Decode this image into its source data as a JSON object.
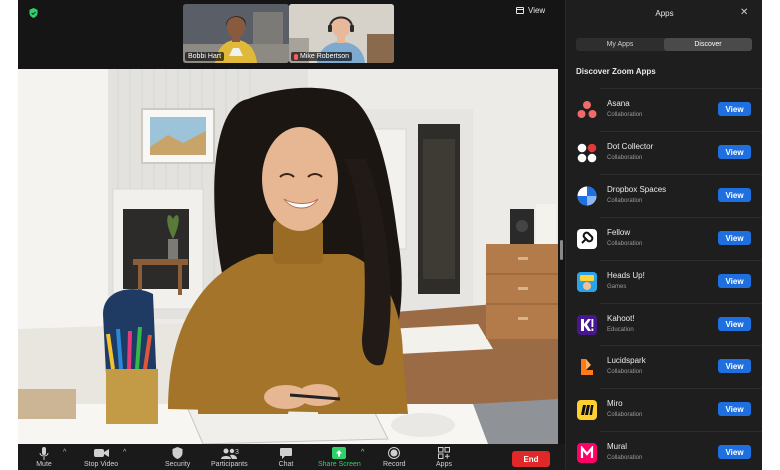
{
  "meeting": {
    "view_label": "View",
    "participants": [
      {
        "name": "Bobbi Hart",
        "muted": false
      },
      {
        "name": "Mike Robertson",
        "muted": true
      }
    ]
  },
  "toolbar": {
    "items": [
      {
        "label": "Mute",
        "icon": "microphone-icon"
      },
      {
        "label": "Stop Video",
        "icon": "video-camera-icon"
      },
      {
        "label": "Security",
        "icon": "shield-icon"
      },
      {
        "label": "Participants",
        "icon": "participants-icon",
        "count": "3"
      },
      {
        "label": "Chat",
        "icon": "chat-bubble-icon"
      },
      {
        "label": "Share Screen",
        "icon": "share-screen-icon"
      },
      {
        "label": "Record",
        "icon": "record-icon"
      },
      {
        "label": "Apps",
        "icon": "apps-icon"
      }
    ],
    "end_label": "End"
  },
  "apps_panel": {
    "title": "Apps",
    "tabs": [
      "My Apps",
      "Discover"
    ],
    "active_tab": "Discover",
    "section_title": "Discover Zoom Apps",
    "view_label": "View",
    "apps": [
      {
        "name": "Asana",
        "category": "Collaboration",
        "icon": "asana-icon"
      },
      {
        "name": "Dot Collector",
        "category": "Collaboration",
        "icon": "dot-collector-icon"
      },
      {
        "name": "Dropbox Spaces",
        "category": "Collaboration",
        "icon": "dropbox-spaces-icon"
      },
      {
        "name": "Fellow",
        "category": "Collaboration",
        "icon": "fellow-icon"
      },
      {
        "name": "Heads Up!",
        "category": "Games",
        "icon": "heads-up-icon"
      },
      {
        "name": "Kahoot!",
        "category": "Education",
        "icon": "kahoot-icon"
      },
      {
        "name": "Lucidspark",
        "category": "Collaboration",
        "icon": "lucidspark-icon"
      },
      {
        "name": "Miro",
        "category": "Collaboration",
        "icon": "miro-icon"
      },
      {
        "name": "Mural",
        "category": "Collaboration",
        "icon": "mural-icon"
      }
    ]
  },
  "colors": {
    "accent_blue": "#1e6fe0",
    "end_red": "#e02828",
    "share_green": "#2fd06a",
    "panel_bg": "#1e1e1e"
  }
}
